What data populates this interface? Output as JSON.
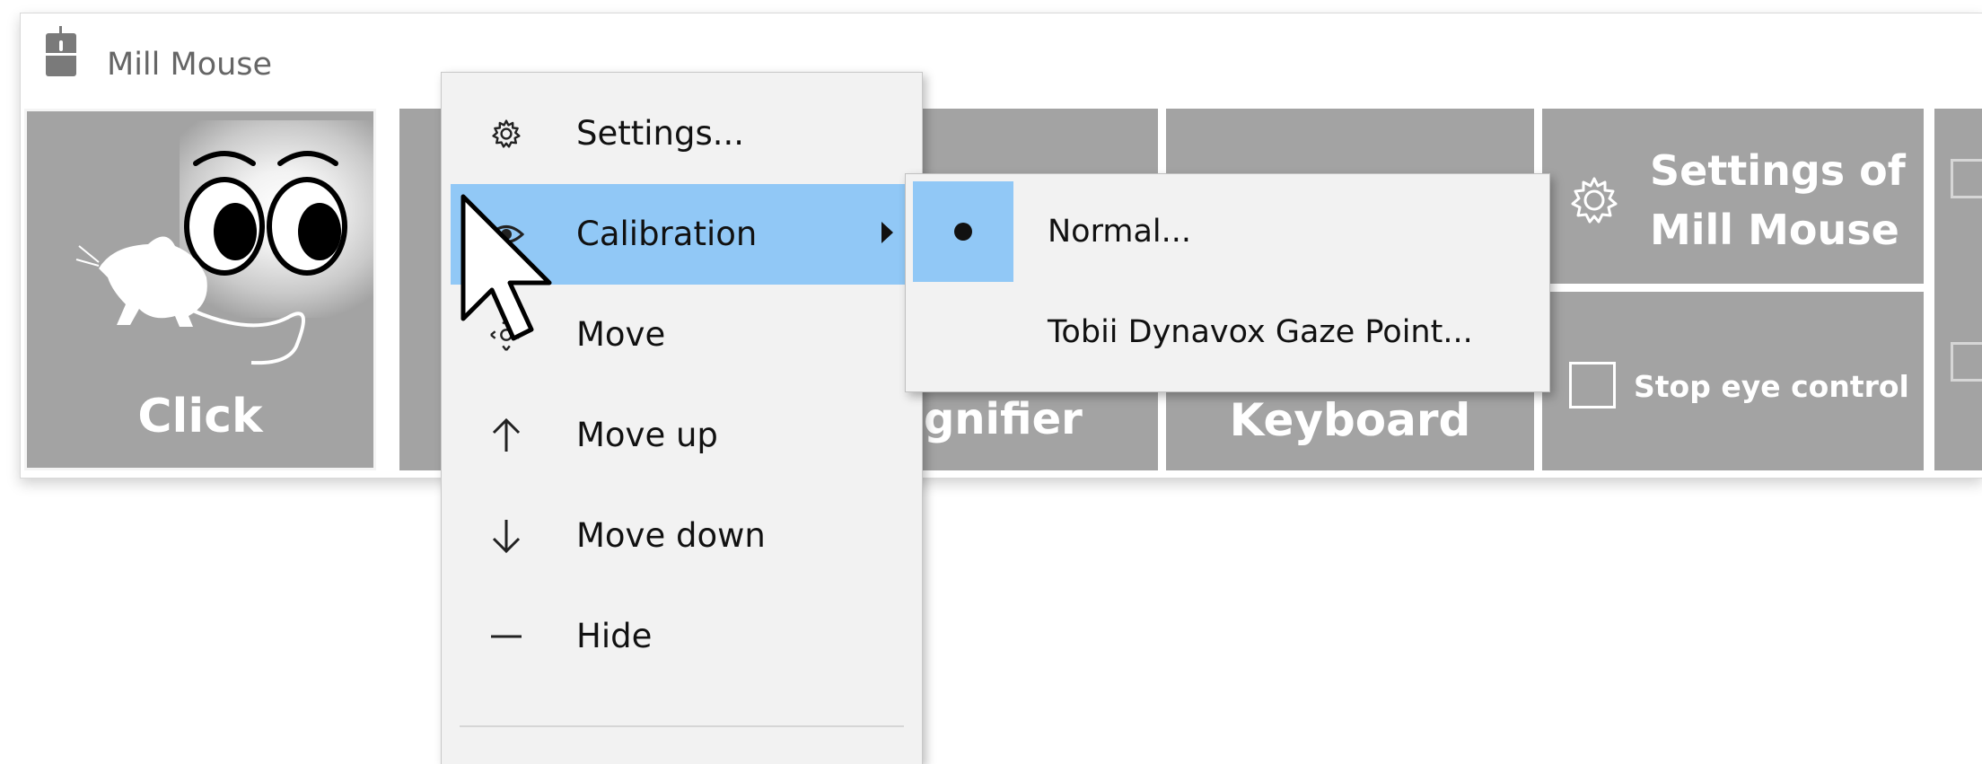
{
  "window": {
    "title": "Mill Mouse"
  },
  "toolbar": {
    "click_label": "Click",
    "magnifier_label": "gnifier",
    "keyboard_label": "Keyboard",
    "settings_label_line1": "Settings of",
    "settings_label_line2": "Mill Mouse",
    "stop_eye_control_label": "Stop eye control",
    "stop_eye_control_checked": false
  },
  "context_menu": {
    "items": [
      {
        "label": "Settings...",
        "icon": "gear-icon"
      },
      {
        "label": "Calibration",
        "icon": "eye-icon",
        "has_submenu": true,
        "highlighted": true
      },
      {
        "label": "Move",
        "icon": "move-icon"
      },
      {
        "label": "Move up",
        "icon": "arrow-up-icon"
      },
      {
        "label": "Move down",
        "icon": "arrow-down-icon"
      },
      {
        "label": "Hide",
        "icon": "minus-icon"
      }
    ]
  },
  "calibration_submenu": {
    "items": [
      {
        "label": "Normal...",
        "selected": true
      },
      {
        "label": "Tobii Dynavox Gaze Point...",
        "selected": false
      }
    ]
  },
  "colors": {
    "tile": "#a3a3a3",
    "highlight": "#91c8f6",
    "menu_bg": "#f2f2f2"
  }
}
